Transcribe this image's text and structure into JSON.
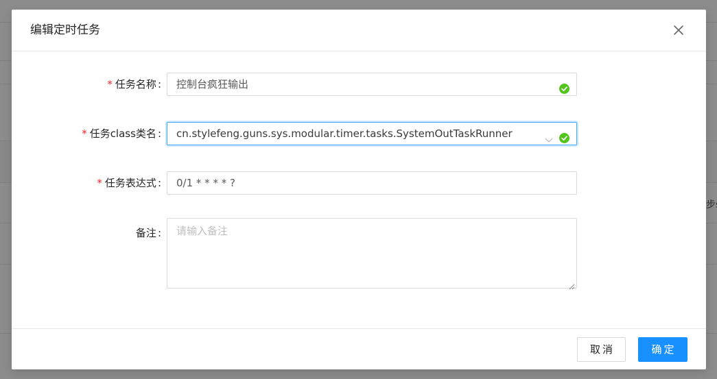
{
  "background": {
    "peek_text": "步s"
  },
  "modal": {
    "title": "编辑定时任务",
    "close_icon": "close-icon",
    "fields": {
      "task_name": {
        "required_mark": "*",
        "label": "任务名称",
        "value": "控制台疯狂输出",
        "status_icon": "success-check-icon"
      },
      "task_class": {
        "required_mark": "*",
        "label": "任务class类名",
        "value": "cn.stylefeng.guns.sys.modular.timer.tasks.SystemOutTaskRunner",
        "status_icon": "success-check-icon",
        "dropdown_icon": "chevron-down-icon"
      },
      "cron": {
        "required_mark": "*",
        "label": "任务表达式",
        "value": "0/1 * * * * ?"
      },
      "remark": {
        "label": "备注",
        "placeholder": "请输入备注",
        "value": ""
      },
      "colon": ":"
    },
    "footer": {
      "cancel_label": "取消",
      "ok_label": "确定"
    }
  },
  "colors": {
    "primary": "#1890ff",
    "success": "#52c41a",
    "required": "#f5222d",
    "mask": "rgba(0,0,0,0.45)"
  }
}
